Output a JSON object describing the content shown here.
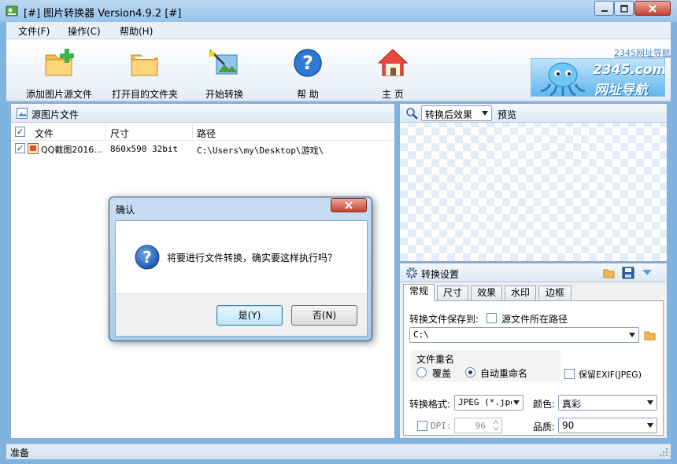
{
  "window": {
    "title": "[#] 图片转换器 Version4.9.2 [#]"
  },
  "menu": [
    "文件(F)",
    "操作(C)",
    "帮助(H)"
  ],
  "toolbar": {
    "add_source": "添加图片源文件",
    "open_target": "打开目的文件夹",
    "start": "开始转换",
    "help": "帮 助",
    "home": "主 页"
  },
  "ad": {
    "link": "2345网址导航",
    "text1": "2345.com",
    "text2": "网址导航"
  },
  "source_panel": {
    "title": "源图片文件",
    "columns": [
      "文件",
      "尺寸",
      "路径"
    ],
    "rows": [
      {
        "checked": true,
        "file": "QQ截图2016...",
        "size": "860x590  32bit",
        "path": "C:\\Users\\my\\Desktop\\游戏\\"
      }
    ]
  },
  "preview": {
    "mode": "转换后效果",
    "label": "预览"
  },
  "settings": {
    "title": "转换设置",
    "tabs": [
      "常规",
      "尺寸",
      "效果",
      "水印",
      "边框"
    ],
    "save_to_label": "转换文件保存到:",
    "source_path_label": "源文件所在路径",
    "save_path": "C:\\",
    "rename_group": "文件重名",
    "overwrite": "覆盖",
    "auto_rename": "自动重命名",
    "keep_exif": "保留EXIF(JPEG)",
    "format_label": "转换格式:",
    "format_value": "JPEG (*.jpg",
    "color_label": "颜色:",
    "color_value": "真彩",
    "dpi_label": "DPI:",
    "dpi_value": "96",
    "quality_label": "品质:",
    "quality_value": "90"
  },
  "status": "准备",
  "dialog": {
    "title": "确认",
    "message": "将要进行文件转换，确实要这样执行吗？",
    "yes": "是(Y)",
    "no": "否(N)"
  }
}
